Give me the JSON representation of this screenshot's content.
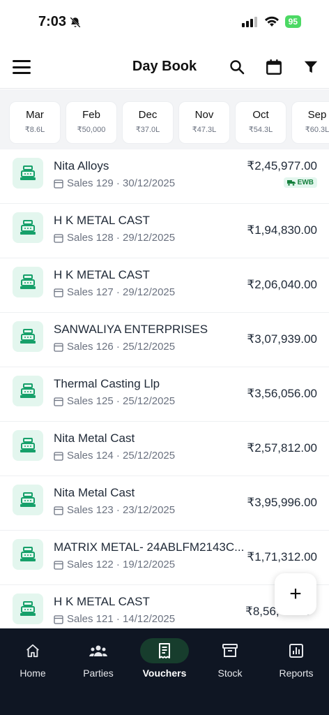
{
  "status": {
    "time": "7:03",
    "battery": "95"
  },
  "header": {
    "title": "Day Book"
  },
  "months": [
    {
      "name": "Mar",
      "amount": "₹8.6L"
    },
    {
      "name": "Feb",
      "amount": "₹50,000"
    },
    {
      "name": "Dec",
      "amount": "₹37.0L"
    },
    {
      "name": "Nov",
      "amount": "₹47.3L"
    },
    {
      "name": "Oct",
      "amount": "₹54.3L"
    },
    {
      "name": "Sep",
      "amount": "₹60.3L"
    }
  ],
  "vouchers": [
    {
      "party": "Nita Alloys",
      "meta": "Sales 129 · 30/12/2025",
      "amount": "₹2,45,977.00",
      "badge": "EWB"
    },
    {
      "party": "H K METAL CAST",
      "meta": "Sales 128 · 29/12/2025",
      "amount": "₹1,94,830.00"
    },
    {
      "party": "H K METAL CAST",
      "meta": "Sales 127 · 29/12/2025",
      "amount": "₹2,06,040.00"
    },
    {
      "party": "SANWALIYA ENTERPRISES",
      "meta": "Sales 126 · 25/12/2025",
      "amount": "₹3,07,939.00"
    },
    {
      "party": "Thermal Casting Llp",
      "meta": "Sales 125 · 25/12/2025",
      "amount": "₹3,56,056.00"
    },
    {
      "party": "Nita Metal Cast",
      "meta": "Sales 124 · 25/12/2025",
      "amount": "₹2,57,812.00"
    },
    {
      "party": "Nita Metal Cast",
      "meta": "Sales 123 · 23/12/2025",
      "amount": "₹3,95,996.00"
    },
    {
      "party": "MATRIX METAL- 24ABLFM2143C...",
      "meta": "Sales 122 · 19/12/2025",
      "amount": "₹1,71,312.00"
    },
    {
      "party": "H K METAL CAST",
      "meta": "Sales 121 · 14/12/2025",
      "amount": "₹8,56,",
      "amount_tail": "0"
    }
  ],
  "fab": {
    "label": "+"
  },
  "nav": [
    {
      "label": "Home",
      "icon": "home-icon"
    },
    {
      "label": "Parties",
      "icon": "people-icon"
    },
    {
      "label": "Vouchers",
      "icon": "receipt-icon",
      "active": true
    },
    {
      "label": "Stock",
      "icon": "archive-box-icon"
    },
    {
      "label": "Reports",
      "icon": "bar-chart-icon"
    }
  ],
  "colors": {
    "accent": "#16a06a",
    "icon_bg": "#e3f6ee",
    "nav_bg": "#0f1623",
    "nav_active": "#173d2d"
  }
}
